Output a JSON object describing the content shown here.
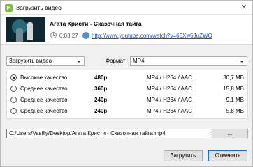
{
  "window": {
    "title": "Загрузить видео",
    "close_label": "✕"
  },
  "video": {
    "title": "Агата Кристи - Сказочная тайга",
    "duration": "0:03:27",
    "url": "http://www.youtube.com/watch?v=66Xw5JuZWO"
  },
  "controls": {
    "download_type": "Загрузить видео",
    "format_label": "Формат:",
    "format_value": "MP4"
  },
  "qualities": [
    {
      "label": "Высокое качество",
      "resolution": "480p",
      "codec": "MP4 / H264 / AAC",
      "size": "30,7 MB",
      "selected": true
    },
    {
      "label": "Среднее качество",
      "resolution": "360p",
      "codec": "MP4 / H264 / AAC",
      "size": "15,8 MB",
      "selected": false
    },
    {
      "label": "Среднее качество",
      "resolution": "240p",
      "codec": "MP4 / H264 / AAC",
      "size": "9,1 MB",
      "selected": false
    },
    {
      "label": "Среднее качество",
      "resolution": "240p",
      "codec": "MP4 / H264 / AAC",
      "size": "5,8 MB",
      "selected": false
    }
  ],
  "output": {
    "path": "C:/Users/Vasiliy/Desktop/Агата Кристи - Сказочная тайга.mp4",
    "browse_label": "..."
  },
  "buttons": {
    "download": "Загрузить",
    "cancel": "Отменить"
  }
}
